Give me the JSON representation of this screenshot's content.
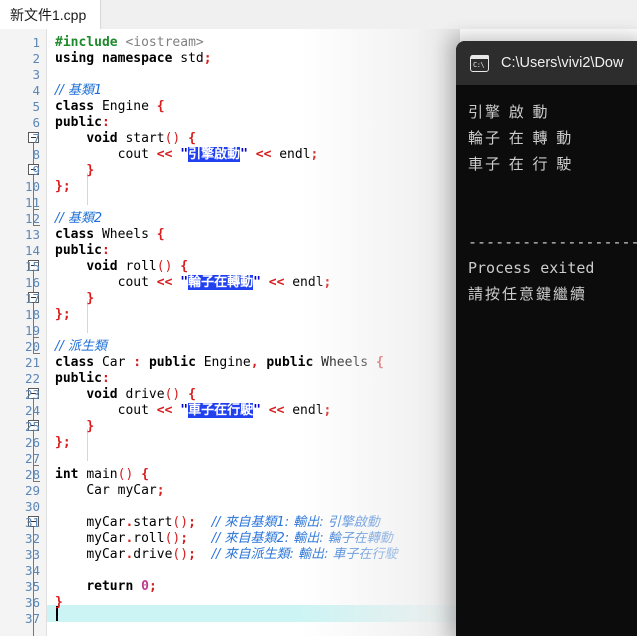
{
  "window": {
    "tab_label": "新文件1.cpp"
  },
  "editor": {
    "current_line": 37,
    "total_lines_visible": 37,
    "line_numbers": [
      1,
      2,
      3,
      4,
      5,
      6,
      7,
      8,
      9,
      10,
      11,
      12,
      13,
      14,
      15,
      16,
      17,
      18,
      19,
      20,
      21,
      22,
      23,
      24,
      25,
      26,
      27,
      28,
      29,
      30,
      31,
      32,
      33,
      34,
      35,
      36,
      37
    ],
    "code_lines": [
      {
        "n": 1,
        "text": "#include <iostream>"
      },
      {
        "n": 2,
        "text": "using namespace std;"
      },
      {
        "n": 3,
        "text": ""
      },
      {
        "n": 4,
        "text": "    // 基類1"
      },
      {
        "n": 5,
        "text": "class Engine {"
      },
      {
        "n": 6,
        "text": "public:"
      },
      {
        "n": 7,
        "text": "    void start() {"
      },
      {
        "n": 8,
        "text": "        cout << \"引擎啟動\" << endl;"
      },
      {
        "n": 9,
        "text": "    }"
      },
      {
        "n": 10,
        "text": "};"
      },
      {
        "n": 11,
        "text": ""
      },
      {
        "n": 12,
        "text": "    // 基類2"
      },
      {
        "n": 13,
        "text": "class Wheels {"
      },
      {
        "n": 14,
        "text": "public:"
      },
      {
        "n": 15,
        "text": "    void roll() {"
      },
      {
        "n": 16,
        "text": "        cout << \"輪子在轉動\" << endl;"
      },
      {
        "n": 17,
        "text": "    }"
      },
      {
        "n": 18,
        "text": "};"
      },
      {
        "n": 19,
        "text": ""
      },
      {
        "n": 20,
        "text": "    // 派生類"
      },
      {
        "n": 21,
        "text": "class Car : public Engine, public Wheels {"
      },
      {
        "n": 22,
        "text": "public:"
      },
      {
        "n": 23,
        "text": "    void drive() {"
      },
      {
        "n": 24,
        "text": "        cout << \"車子在行駛\" << endl;"
      },
      {
        "n": 25,
        "text": "    }"
      },
      {
        "n": 26,
        "text": "};"
      },
      {
        "n": 27,
        "text": ""
      },
      {
        "n": 28,
        "text": "int main() {"
      },
      {
        "n": 29,
        "text": "    Car myCar;"
      },
      {
        "n": 30,
        "text": ""
      },
      {
        "n": 31,
        "text": "    myCar.start();   // 來自基類1: 輸出: 引擎啟動"
      },
      {
        "n": 32,
        "text": "    myCar.roll();    // 來自基類2: 輸出: 輪子在轉動"
      },
      {
        "n": 33,
        "text": "    myCar.drive();   // 來自派生類: 輸出: 車子在行駛"
      },
      {
        "n": 34,
        "text": ""
      },
      {
        "n": 35,
        "text": "    return 0;"
      },
      {
        "n": 36,
        "text": "}"
      },
      {
        "n": 37,
        "text": ""
      }
    ],
    "tokens": {
      "include_directive": "#include",
      "include_header": "<iostream>",
      "kw_using": "using",
      "kw_namespace": "namespace",
      "id_std": "std",
      "kw_class": "class",
      "kw_public": "public",
      "kw_int": "int",
      "kw_return": "return",
      "id_engine": "Engine",
      "id_wheels": "Wheels",
      "id_car": "Car",
      "id_main": "main",
      "id_cout": "cout",
      "id_endl": "endl",
      "id_mycar": "myCar",
      "fn_start": "start",
      "fn_roll": "roll",
      "fn_drive": "drive",
      "num_zero": "0",
      "str_engine": "引擎啟動",
      "str_wheels": "輪子在轉動",
      "str_car": "車子在行駛",
      "cmt_base1": "// 基類1",
      "cmt_base2": "// 基類2",
      "cmt_derived": "// 派生類",
      "cmt_call1": "// 來自基類1: 輸出: 引擎啟動",
      "cmt_call2": "// 來自基類2: 輸出: 輪子在轉動",
      "cmt_call3": "// 來自派生類: 輸出: 車子在行駛"
    },
    "colors": {
      "preprocessor": "#1f8a2c",
      "header": "#808080",
      "keyword": "#000000",
      "punctuation": "#d61d1d",
      "number": "#c23a8e",
      "string": "#0000d2",
      "comment": "#1d6fd6",
      "selection": "#2140f0",
      "line_number": "#5b87b5",
      "current_line": "#cdf4f4"
    }
  },
  "console": {
    "icon": "cmd-icon",
    "icon_text": "C:\\",
    "title": "C:\\Users\\vivi2\\Dow",
    "output_lines": [
      "引擎 啟 動",
      "輪子 在 轉 動",
      "車子 在 行 駛"
    ],
    "separator": "--------------------------",
    "exit_line": "Process exited",
    "prompt_line": "請按任意鍵繼續",
    "colors": {
      "background": "#0c0c0c",
      "titlebar": "#2d2d2d",
      "text": "#cccccc"
    }
  }
}
